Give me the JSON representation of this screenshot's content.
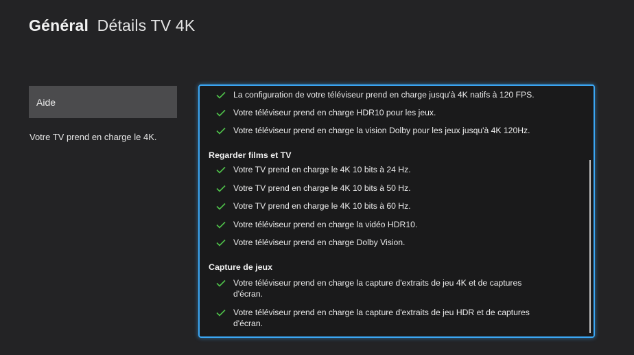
{
  "header": {
    "section": "Général",
    "page_title": "Détails TV 4K"
  },
  "sidebar": {
    "help_label": "Aide",
    "description": "Votre TV prend en charge le 4K."
  },
  "colors": {
    "accent": "#3ba7f5",
    "check": "#4fc24a"
  },
  "details": {
    "intro_items": [
      "La configuration de votre téléviseur prend en charge jusqu'à 4K natifs à 120 FPS.",
      "Votre téléviseur prend en charge HDR10 pour les jeux.",
      "Votre téléviseur prend en charge la vision Dolby pour les jeux jusqu'à 4K 120Hz."
    ],
    "sections": [
      {
        "title": "Regarder films et TV",
        "items": [
          "Votre TV prend en charge le 4K 10 bits à 24 Hz.",
          "Votre TV prend en charge le 4K 10 bits à 50 Hz.",
          "Votre TV prend en charge le 4K 10 bits à 60 Hz.",
          "Votre téléviseur prend en charge la vidéo HDR10.",
          "Votre téléviseur prend en charge Dolby Vision."
        ]
      },
      {
        "title": "Capture de jeux",
        "items": [
          "Votre téléviseur prend en charge la capture d'extraits de jeu 4K et de captures d'écran.",
          "Votre téléviseur prend en charge la capture d'extraits de jeu HDR et de captures d'écran."
        ]
      }
    ]
  }
}
